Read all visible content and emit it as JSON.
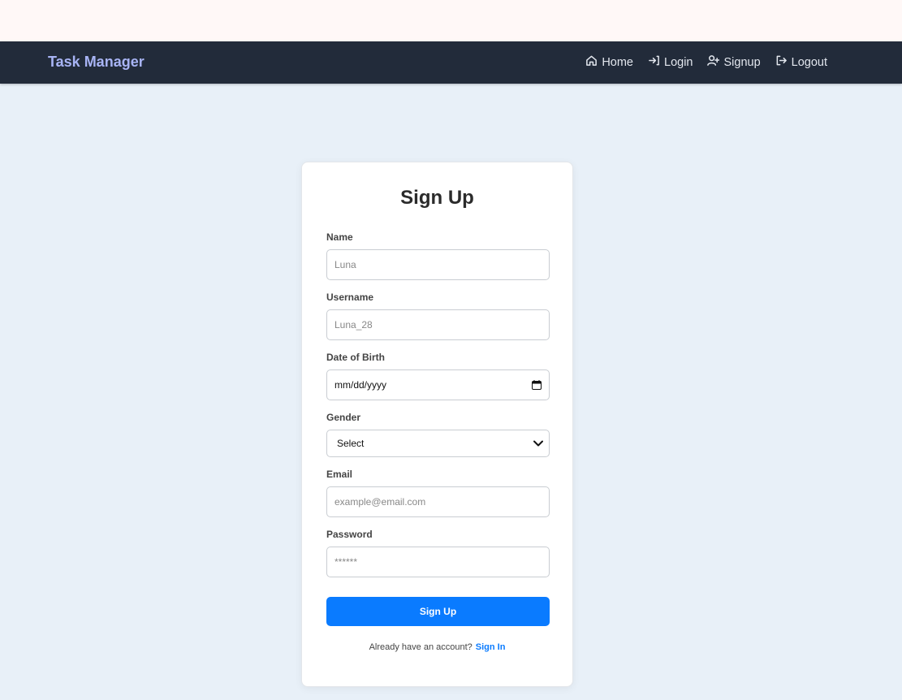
{
  "navbar": {
    "brand": "Task Manager",
    "links": [
      {
        "label": "Home",
        "icon": "home-icon"
      },
      {
        "label": "Login",
        "icon": "login-icon"
      },
      {
        "label": "Signup",
        "icon": "user-plus-icon"
      },
      {
        "label": "Logout",
        "icon": "logout-icon"
      }
    ]
  },
  "form": {
    "title": "Sign Up",
    "name": {
      "label": "Name",
      "placeholder": "Luna"
    },
    "username": {
      "label": "Username",
      "placeholder": "Luna_28"
    },
    "dob": {
      "label": "Date of Birth",
      "value": "mm/dd/yyyy"
    },
    "gender": {
      "label": "Gender",
      "selected": "Select"
    },
    "email": {
      "label": "Email",
      "placeholder": "example@email.com"
    },
    "password": {
      "label": "Password",
      "placeholder": "******"
    },
    "submit_label": "Sign Up",
    "footer_text": "Already have an account?",
    "footer_link": "Sign In"
  },
  "colors": {
    "navbar_bg": "#222b3a",
    "brand": "#a8b4f5",
    "accent": "#0a7bff",
    "page_bg": "#e8f0f8"
  }
}
